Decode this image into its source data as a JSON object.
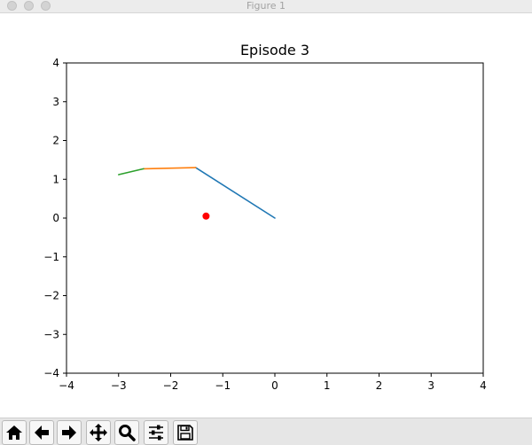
{
  "window": {
    "title": "Figure 1"
  },
  "toolbar": {
    "buttons": [
      {
        "name": "home-button",
        "icon": "home-icon"
      },
      {
        "name": "back-button",
        "icon": "arrow-left-icon"
      },
      {
        "name": "forward-button",
        "icon": "arrow-right-icon"
      },
      {
        "name": "pan-button",
        "icon": "move-icon"
      },
      {
        "name": "zoom-button",
        "icon": "magnifier-icon"
      },
      {
        "name": "configure-subplots-button",
        "icon": "sliders-icon"
      },
      {
        "name": "save-button",
        "icon": "floppy-disk-icon"
      }
    ]
  },
  "chart_data": {
    "type": "line",
    "title": "Episode 3",
    "xlabel": "",
    "ylabel": "",
    "xlim": [
      -4,
      4
    ],
    "ylim": [
      -4,
      4
    ],
    "xticks": [
      "−4",
      "−3",
      "−2",
      "−1",
      "0",
      "1",
      "2",
      "3",
      "4"
    ],
    "yticks": [
      "−4",
      "−3",
      "−2",
      "−1",
      "0",
      "1",
      "2",
      "3",
      "4"
    ],
    "xtick_values": [
      -4,
      -3,
      -2,
      -1,
      0,
      1,
      2,
      3,
      4
    ],
    "ytick_values": [
      -4,
      -3,
      -2,
      -1,
      0,
      1,
      2,
      3,
      4
    ],
    "grid": false,
    "series": [
      {
        "color": "#1f77b4",
        "x": [
          0,
          -1.52
        ],
        "y": [
          0,
          1.3
        ]
      },
      {
        "color": "#ff7f0e",
        "x": [
          -1.52,
          -2.52
        ],
        "y": [
          1.3,
          1.27
        ]
      },
      {
        "color": "#2ca02c",
        "x": [
          -2.52,
          -3.0
        ],
        "y": [
          1.27,
          1.12
        ]
      }
    ],
    "points": [
      {
        "color": "#ff0000",
        "x": -1.32,
        "y": 0.05
      }
    ]
  }
}
